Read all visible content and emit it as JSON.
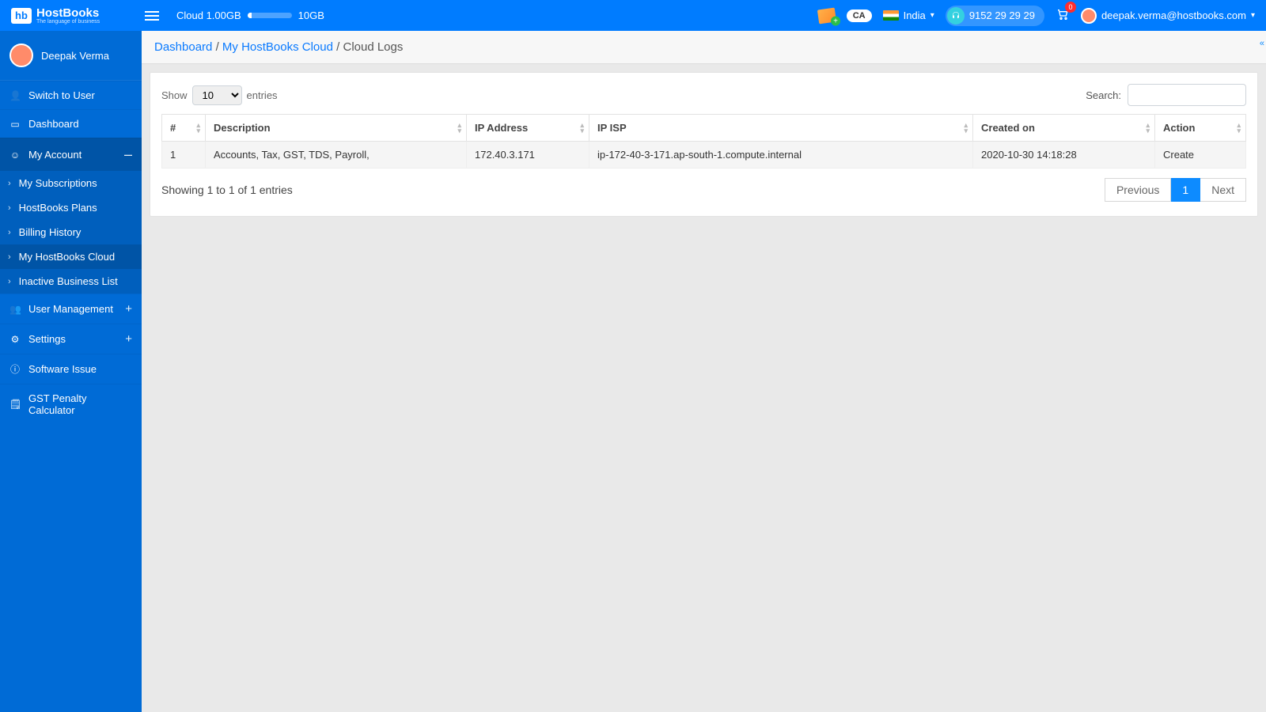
{
  "brand": {
    "badge": "hb",
    "name": "HostBooks",
    "tagline": "The language of business"
  },
  "topbar": {
    "cloud_label": "Cloud 1.00GB",
    "cloud_used_pct": 10,
    "cloud_total": "10GB",
    "ca_pill": "CA",
    "country": "India",
    "support_phone": "9152 29 29 29",
    "cart_count": "0",
    "user_email": "deepak.verma@hostbooks.com"
  },
  "sidebar": {
    "user_name": "Deepak Verma",
    "items": {
      "switch_user": "Switch to User",
      "dashboard": "Dashboard",
      "my_account": "My Account",
      "subs": "My Subscriptions",
      "plans": "HostBooks Plans",
      "billing": "Billing History",
      "cloud": "My HostBooks Cloud",
      "inactive": "Inactive Business List",
      "user_mgmt": "User Management",
      "settings": "Settings",
      "software_issue": "Software Issue",
      "gst_calc": "GST Penalty Calculator"
    }
  },
  "breadcrumb": {
    "a": "Dashboard",
    "b": "My HostBooks Cloud",
    "c": "Cloud Logs"
  },
  "datatable": {
    "show_label_pre": "Show",
    "show_value": "10",
    "show_label_post": "entries",
    "search_label": "Search:",
    "columns": [
      "#",
      "Description",
      "IP Address",
      "IP ISP",
      "Created on",
      "Action"
    ],
    "rows": [
      {
        "n": "1",
        "desc": "Accounts, Tax, GST, TDS, Payroll,",
        "ip": "172.40.3.171",
        "isp": "ip-172-40-3-171.ap-south-1.compute.internal",
        "created": "2020-10-30 14:18:28",
        "action": "Create"
      }
    ],
    "info": "Showing 1 to 1 of 1 entries",
    "prev": "Previous",
    "page": "1",
    "next": "Next"
  }
}
